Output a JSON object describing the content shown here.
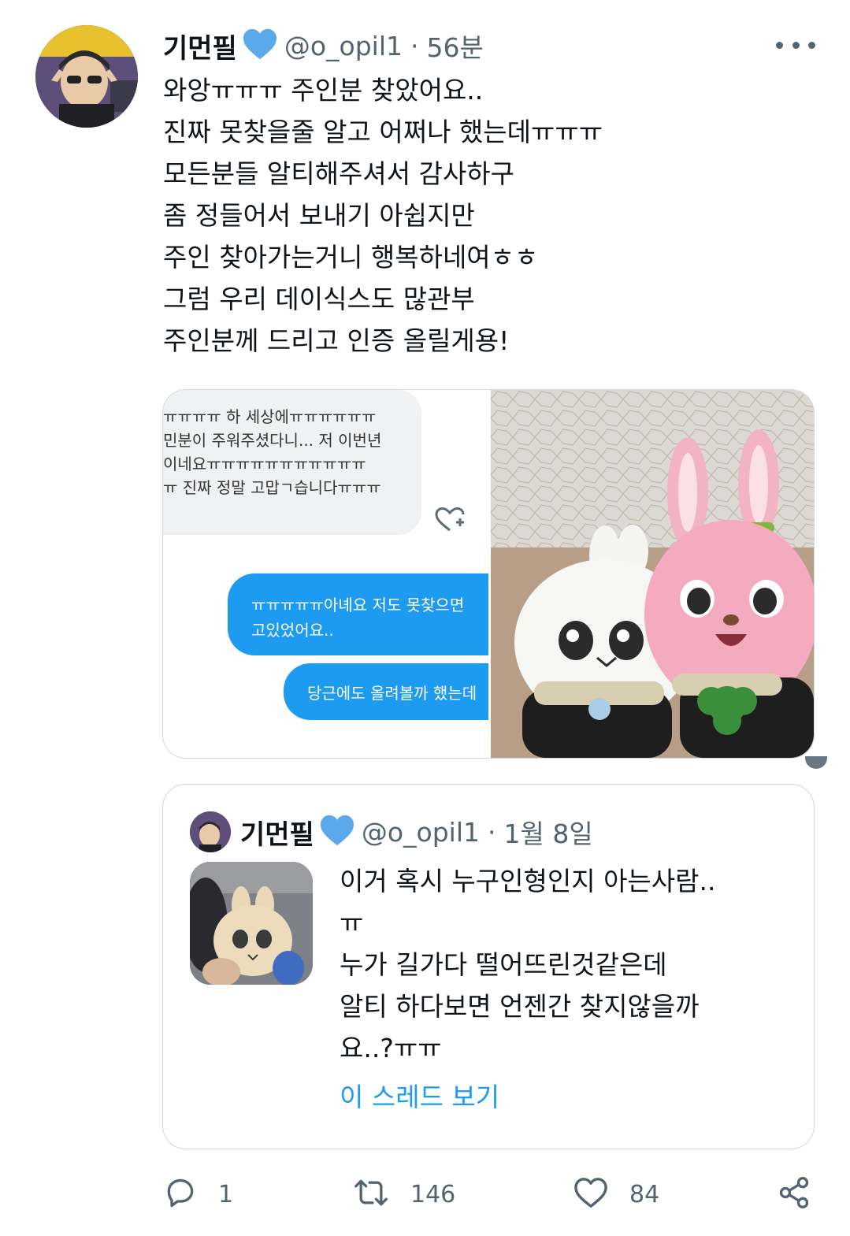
{
  "tweet": {
    "author_name": "기먼필",
    "handle": "@o_opil1",
    "separator": "·",
    "time": "56분",
    "body_lines": [
      "와앙ㅠㅠㅠ 주인분 찾았어요..",
      "진짜 못찾을줄 알고 어쩌나 했는데ㅠㅠㅠ",
      "모든분들 알티해주셔서 감사하구",
      "좀 정들어서 보내기 아쉽지만",
      "주인 찾아가는거니 행복하네여ㅎㅎ",
      "그럼 우리 데이식스도 많관부",
      "주인분께 드리고 인증 올릴게용!"
    ],
    "more_icon": "more-horizontal-icon",
    "verified_icon": "blue-heart-icon"
  },
  "media": {
    "chat": {
      "received_lines": [
        "ㅠㅠㅠㅠ 하 세상에ㅠㅠㅠㅠㅠㅠ",
        "민분이 주워주셨다니... 저 이번년",
        "이네요ㅠㅠㅠㅠㅠㅠㅠㅠㅠㅠㅠ",
        "ㅠ 진짜 정말 고맙ㄱ습니다ㅠㅠㅠ"
      ],
      "sent_bubble_1": [
        "ㅠㅠㅠㅠㅠ아녜요 저도 못찾으면",
        "고있었어요.."
      ],
      "sent_bubble_2": "당근에도 올려볼까 했는데",
      "react_icon": "heart-plus-icon"
    },
    "photo_label": "plush-photo"
  },
  "quote": {
    "author_name": "기먼필",
    "handle": "@o_opil1",
    "separator": "·",
    "time": "1월 8일",
    "body_lines": [
      "이거 혹시 누구인형인지 아는사람..",
      "ㅠ",
      "누가 길가다 떨어뜨린것같은데",
      "알티 하다보면 언젠간 찾지않을까",
      "요..?ㅠㅠ"
    ],
    "show_thread": "이 스레드 보기"
  },
  "actions": {
    "reply": {
      "icon": "reply-icon",
      "count": "1"
    },
    "retweet": {
      "icon": "retweet-icon",
      "count": "146"
    },
    "like": {
      "icon": "heart-icon",
      "count": "84"
    },
    "share": {
      "icon": "share-icon"
    }
  },
  "colors": {
    "accent": "#1d9bf0",
    "text": "#0f1419",
    "secondary": "#536471",
    "border": "#cfd9de"
  }
}
